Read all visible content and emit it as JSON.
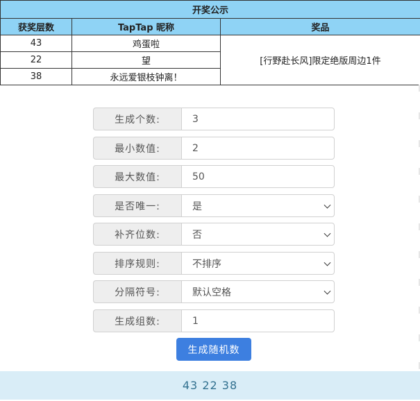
{
  "draw_table": {
    "title": "开奖公示",
    "headers": [
      "获奖层数",
      "TapTap 昵称",
      "奖品"
    ],
    "rows": [
      {
        "floor": "43",
        "nickname": "鸡蛋啦"
      },
      {
        "floor": "22",
        "nickname": "望"
      },
      {
        "floor": "38",
        "nickname": "永远爱银枝钟离！"
      }
    ],
    "prize": "[行野赴长风]限定绝版周边1件"
  },
  "form": {
    "count": {
      "label": "生成个数:",
      "value": "3"
    },
    "min": {
      "label": "最小数值:",
      "value": "2"
    },
    "max": {
      "label": "最大数值:",
      "value": "50"
    },
    "unique": {
      "label": "是否唯一:",
      "value": "是"
    },
    "pad": {
      "label": "补齐位数:",
      "value": "否"
    },
    "sort": {
      "label": "排序规则:",
      "value": "不排序"
    },
    "sep": {
      "label": "分隔符号:",
      "value": "默认空格"
    },
    "groups": {
      "label": "生成组数:",
      "value": "1"
    }
  },
  "generate_button": "生成随机数",
  "result": "43 22 38",
  "icons": {
    "select_arrow": "chevron-down-icon"
  }
}
